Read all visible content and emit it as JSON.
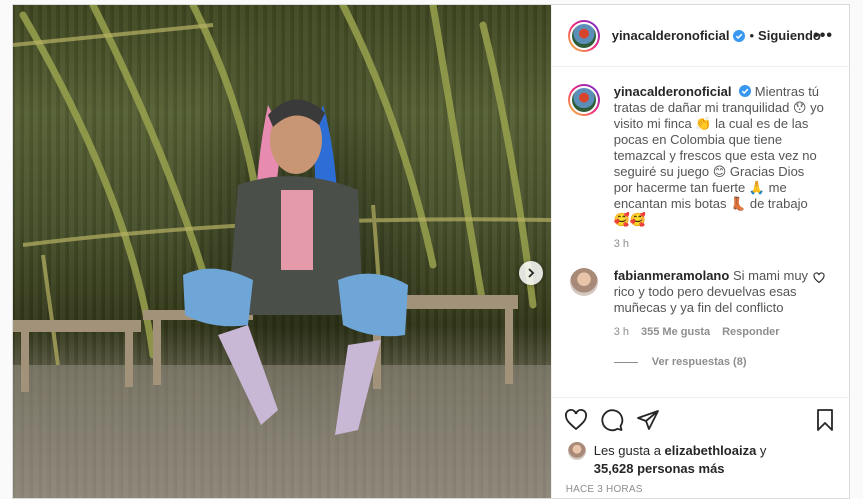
{
  "header": {
    "username": "yinacalderonoficial",
    "separator": "•",
    "follow_status": "Siguiendo",
    "more_label": "•••"
  },
  "caption": {
    "username": "yinacalderonoficial",
    "text": "Mientras tú tratas de dañar mi tranquilidad 😯 yo visito mi finca 👏 la cual es de las pocas en Colombia que tiene temazcal y frescos que esta vez no seguiré su juego 😊 Gracias Dios por hacerme tan fuerte 🙏 me encantan mis botas 👢 de trabajo 🥰🥰",
    "time": "3 h"
  },
  "comment": {
    "username": "fabianmeramolano",
    "text": "Si mami muy rico y todo pero devuelvas esas muñecas y ya fin del conflicto",
    "time": "3 h",
    "likes": "355 Me gusta",
    "reply_label": "Responder"
  },
  "replies": {
    "label": "Ver respuestas (8)"
  },
  "likes": {
    "prefix": "Les gusta a ",
    "user": "elizabethloaiza",
    "connector": " y",
    "count": "35,628 personas más"
  },
  "posted": {
    "label": "HACE 3 HORAS"
  }
}
